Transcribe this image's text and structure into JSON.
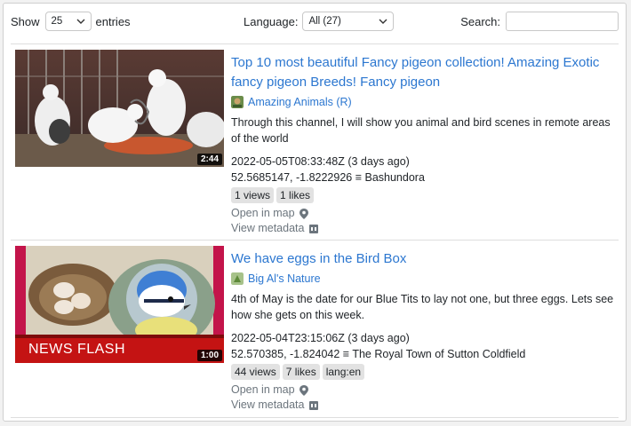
{
  "toolbar": {
    "show_label": "Show",
    "entries_value": "25",
    "entries_label": "entries",
    "language_label": "Language:",
    "language_value": "All (27)",
    "search_label": "Search:",
    "search_value": ""
  },
  "videos": [
    {
      "title": "Top 10 most beautiful Fancy pigeon collection! Amazing Exotic fancy pigeon Breeds! Fancy pigeon",
      "duration": "2:44",
      "channel": "Amazing Animals (R)",
      "description": "Through this channel, I will show you animal and bird scenes in remote areas of the world",
      "published": "2022-05-05T08:33:48Z (3 days ago)",
      "location": "52.5685147, -1.8222926 ≡ Bashundora",
      "badges": [
        "1 views",
        "1 likes"
      ],
      "open_map": "Open in map",
      "view_metadata": "View metadata"
    },
    {
      "title": "We have eggs in the Bird Box",
      "duration": "1:00",
      "overlay_text": "NEWS FLASH",
      "channel": "Big Al's Nature",
      "description": "4th of May is the date for our Blue Tits to lay not one, but three eggs. Lets see how she gets on this week.",
      "published": "2022-05-04T23:15:06Z (3 days ago)",
      "location": "52.570385, -1.824042 ≡ The Royal Town of Sutton Coldfield",
      "badges": [
        "44 views",
        "7 likes",
        "lang:en"
      ],
      "open_map": "Open in map",
      "view_metadata": "View metadata"
    }
  ],
  "colors": {
    "link": "#2c77d0",
    "badge_bg": "#e2e2e2",
    "muted": "#6c757d"
  }
}
